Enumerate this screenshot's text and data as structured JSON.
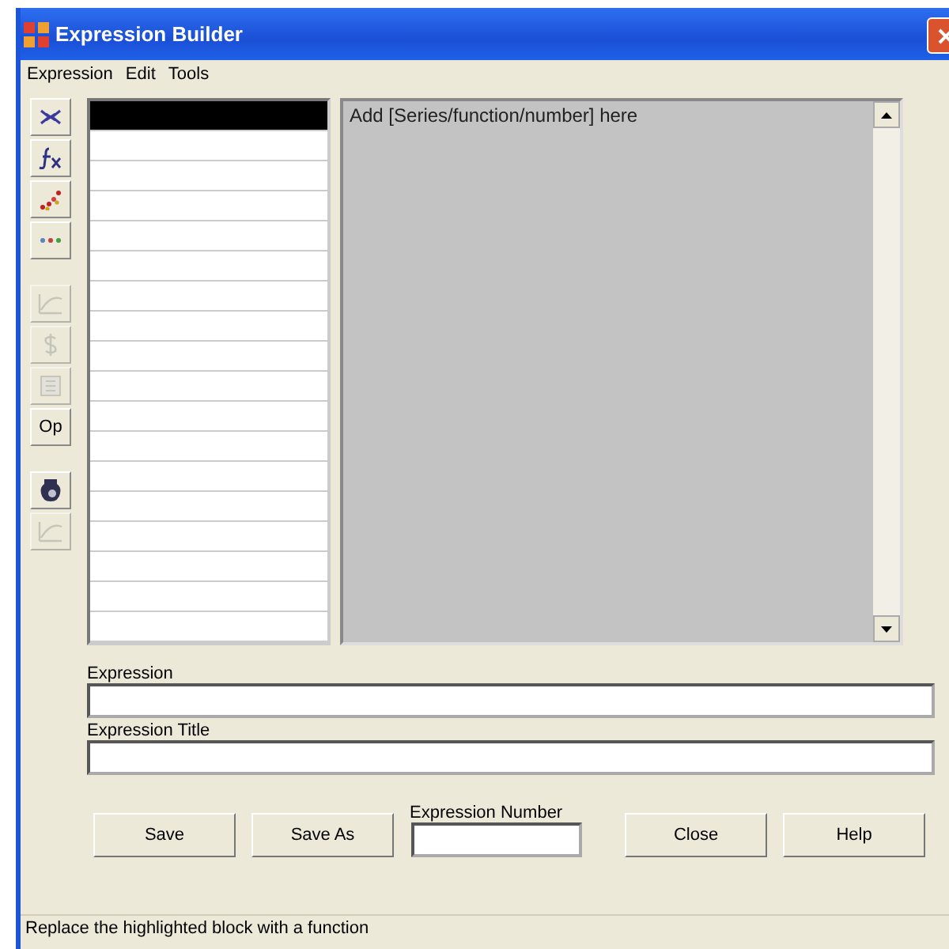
{
  "window": {
    "title": "Expression Builder"
  },
  "menu": [
    "Expression",
    "Edit",
    "Tools"
  ],
  "toolbar": [
    {
      "kind": "join",
      "disabled": false
    },
    {
      "kind": "function",
      "disabled": false
    },
    {
      "kind": "scatter",
      "disabled": false
    },
    {
      "kind": "dots",
      "disabled": false
    },
    {
      "kind": "gap"
    },
    {
      "kind": "curve",
      "disabled": true
    },
    {
      "kind": "dollar",
      "disabled": true
    },
    {
      "kind": "sheet",
      "disabled": true
    },
    {
      "kind": "text",
      "label": "Op",
      "disabled": false
    },
    {
      "kind": "gap"
    },
    {
      "kind": "jar",
      "disabled": false
    },
    {
      "kind": "curve",
      "disabled": true
    }
  ],
  "block_list": {
    "rows": [
      {
        "selected": true
      },
      {
        "selected": false
      },
      {
        "selected": false
      },
      {
        "selected": false
      },
      {
        "selected": false
      },
      {
        "selected": false
      },
      {
        "selected": false
      },
      {
        "selected": false
      },
      {
        "selected": false
      },
      {
        "selected": false
      },
      {
        "selected": false
      },
      {
        "selected": false
      },
      {
        "selected": false
      },
      {
        "selected": false
      },
      {
        "selected": false
      },
      {
        "selected": false
      },
      {
        "selected": false
      },
      {
        "selected": false
      }
    ]
  },
  "editor": {
    "text": "Add [Series/function/number] here"
  },
  "expression": {
    "label": "Expression"
  },
  "expression_title": {
    "label": "Expression Title"
  },
  "buttons": [
    {
      "kind": "button",
      "label": "Save"
    },
    {
      "kind": "button",
      "label": "Save As"
    },
    {
      "kind": "field",
      "label": "Expression Number"
    },
    {
      "kind": "button",
      "label": "Close"
    },
    {
      "kind": "button",
      "label": "Help"
    }
  ],
  "status_bar": "Replace the highlighted block with a function"
}
